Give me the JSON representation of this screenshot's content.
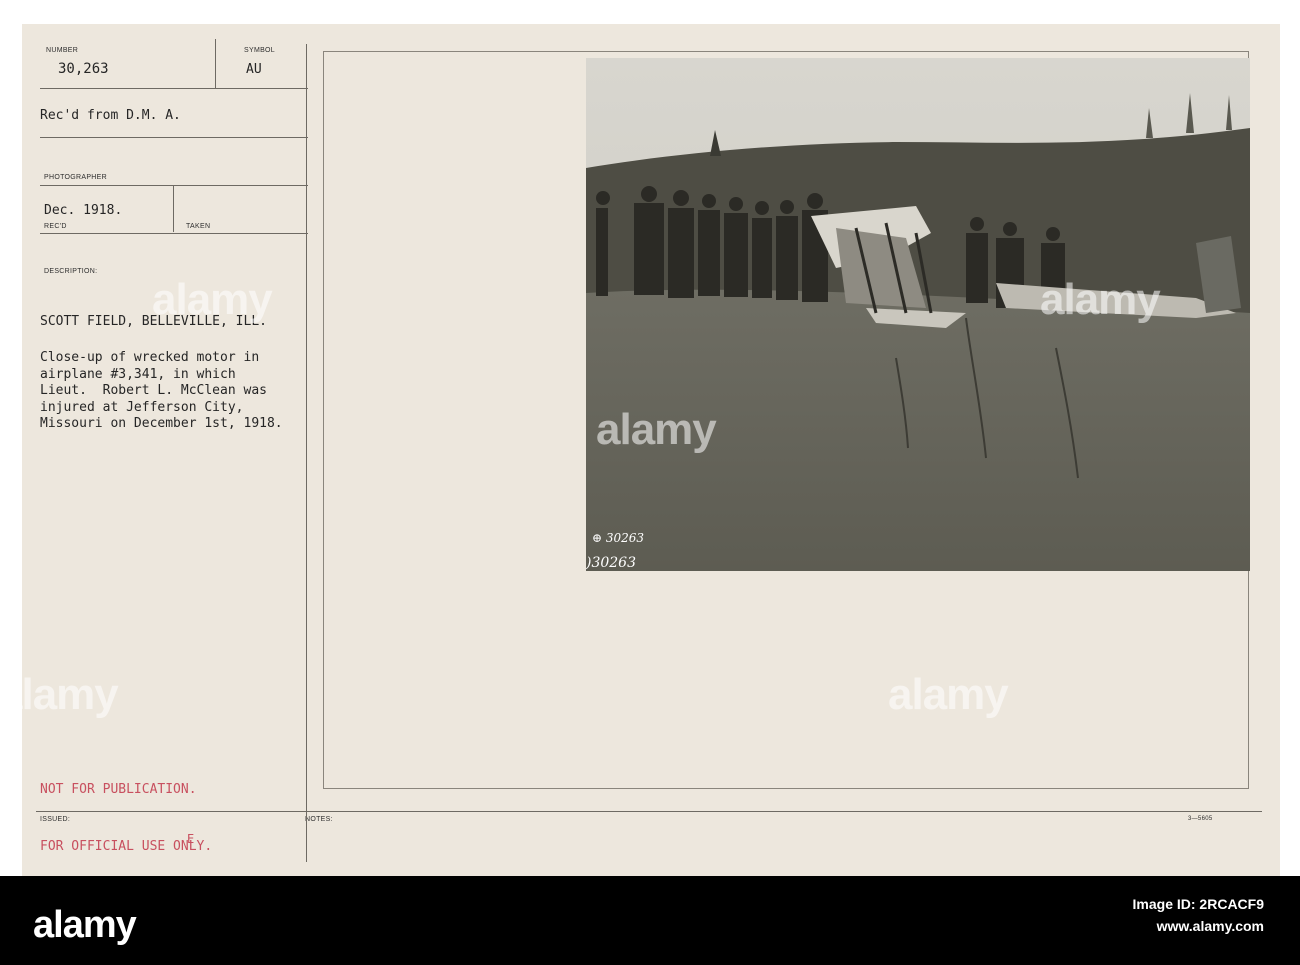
{
  "card": {
    "labels": {
      "number": "NUMBER",
      "symbol": "SYMBOL",
      "photographer": "PHOTOGRAPHER",
      "recd": "REC'D",
      "taken": "TAKEN",
      "description": "DESCRIPTION:",
      "issued": "ISSUED:",
      "notes": "NOTES:"
    },
    "number": "30,263",
    "symbol": "AU",
    "received_from": "Rec'd from D.M. A.",
    "date": "Dec. 1918.",
    "location": "SCOTT FIELD, BELLEVILLE, ILL.",
    "description_lines": [
      "Close-up of wrecked motor in",
      "airplane #3,341, in which",
      "Lieut.  Robert L. McClean was",
      "injured at Jefferson City,",
      "Missouri on December 1st, 1918."
    ],
    "stamp_lines": [
      "NOT FOR PUBLICATION.",
      "FOR OFFICIAL USE ONLY."
    ],
    "issued_mark": "E",
    "form_number": "3—5605"
  },
  "photo": {
    "negative_number": "⊕ 30263",
    "negative_number_2": ")30263"
  },
  "watermark": {
    "text": "alamy"
  },
  "footer": {
    "brand": "alamy",
    "image_id_label": "Image ID: 2RCACF9",
    "url": "www.alamy.com"
  }
}
